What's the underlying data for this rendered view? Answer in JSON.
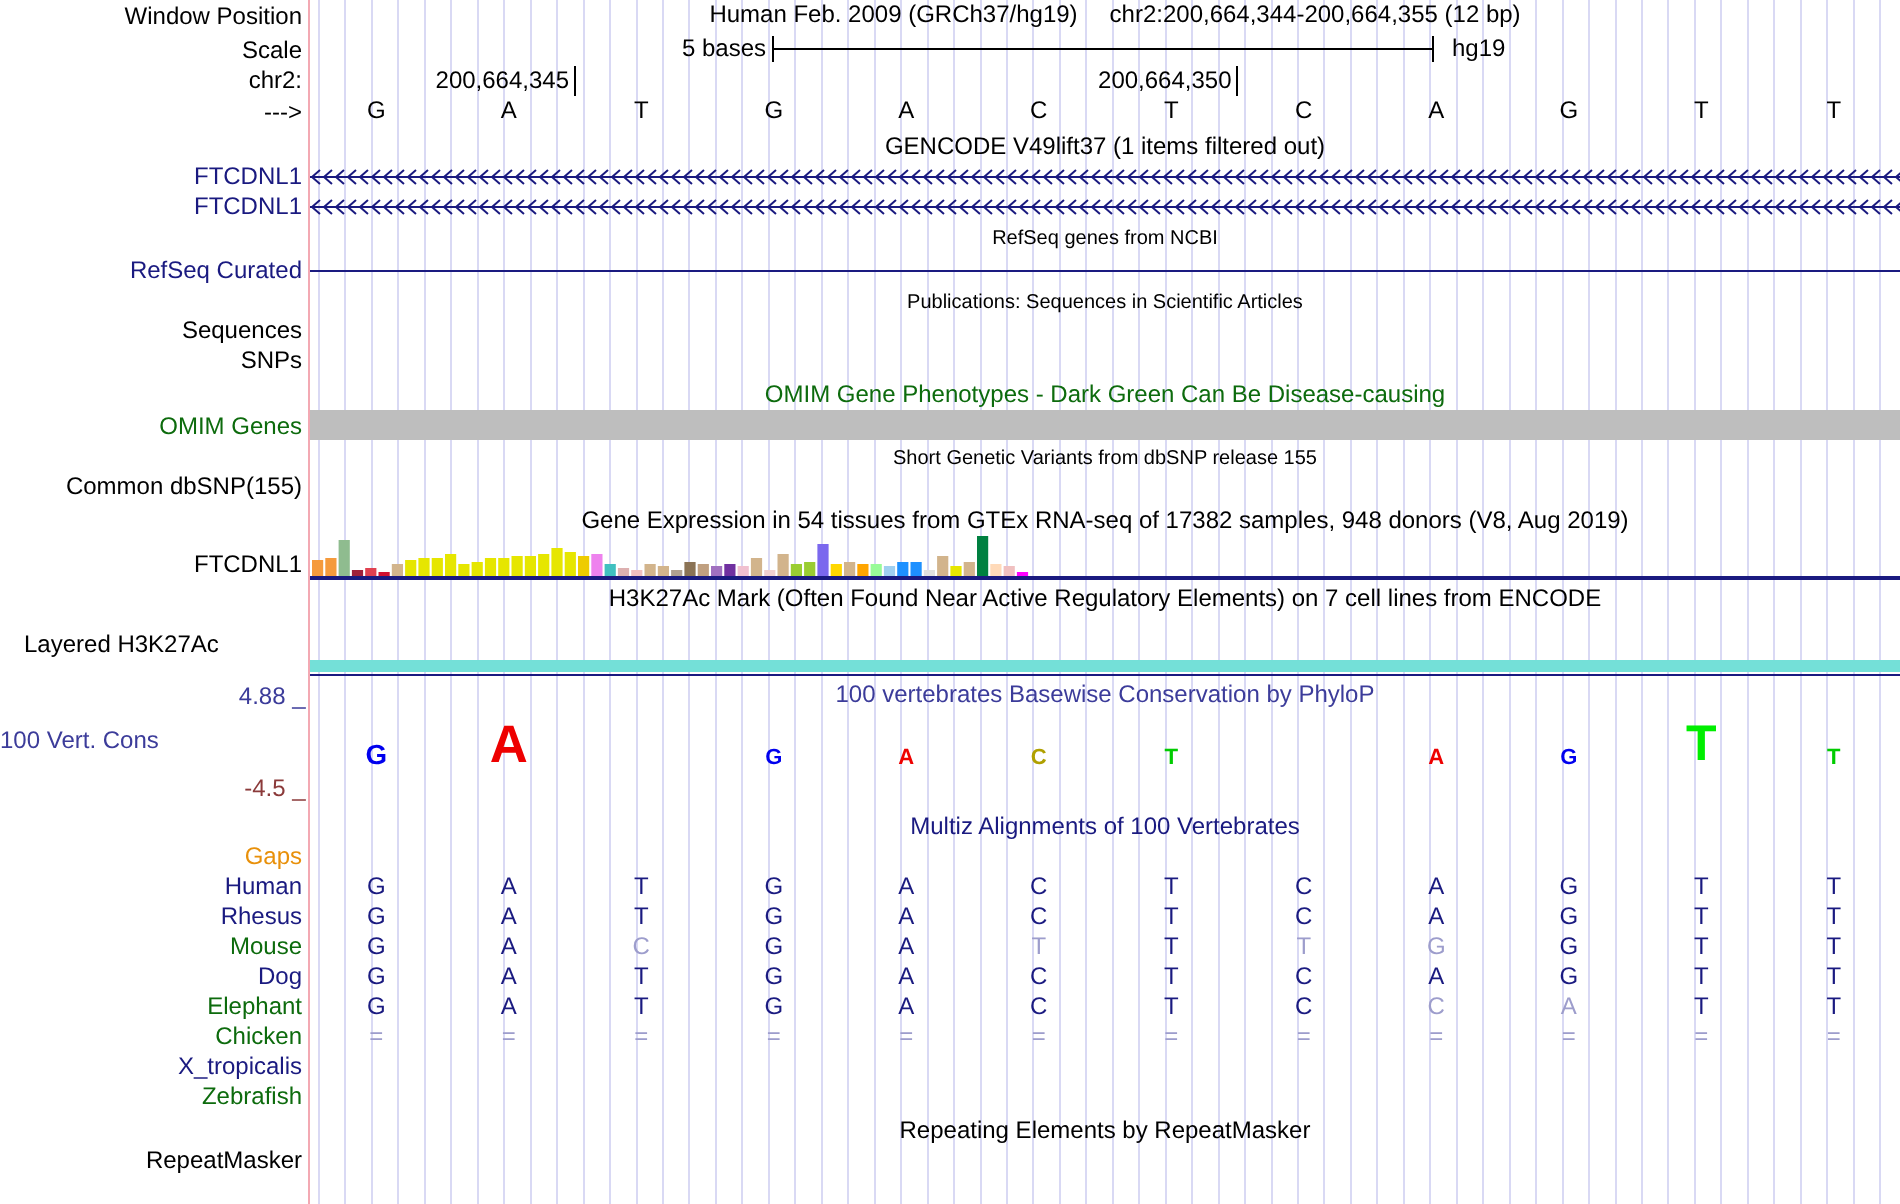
{
  "position_row": {
    "label": "Window Position",
    "assembly": "Human Feb. 2009 (GRCh37/hg19)",
    "range": "chr2:200,664,344-200,664,355 (12 bp)"
  },
  "scale_row": {
    "label": "Scale",
    "span": "5 bases",
    "genome": "hg19"
  },
  "coordinate_row": {
    "label": "chr2:",
    "positions": [
      "200,664,345",
      "200,664,350"
    ]
  },
  "sequence_row": {
    "label": "--->",
    "bases": [
      "G",
      "A",
      "T",
      "G",
      "A",
      "C",
      "T",
      "C",
      "A",
      "G",
      "T",
      "T"
    ]
  },
  "tracks": [
    {
      "kind": "title",
      "text": "GENCODE V49lift37 (1 items filtered out)",
      "color": "#000000"
    },
    {
      "kind": "gene",
      "label": "FTCDNL1",
      "color": "#1a1a80"
    },
    {
      "kind": "gene",
      "label": "FTCDNL1",
      "color": "#1a1a80"
    },
    {
      "kind": "note",
      "text": "RefSeq genes from NCBI"
    },
    {
      "kind": "line",
      "label": "RefSeq Curated",
      "color": "#1a1a80"
    },
    {
      "kind": "note",
      "text": "Publications: Sequences in Scientific Articles"
    },
    {
      "kind": "empty",
      "label": "Sequences",
      "color": "#000000"
    },
    {
      "kind": "empty",
      "label": "SNPs",
      "color": "#000000"
    },
    {
      "kind": "title",
      "text": "OMIM Gene Phenotypes - Dark Green Can Be Disease-causing",
      "color": "#0d6b0d"
    },
    {
      "kind": "bar",
      "label": "OMIM Genes",
      "color": "#0d6b0d"
    },
    {
      "kind": "note",
      "text": "Short Genetic Variants from dbSNP release 155"
    },
    {
      "kind": "empty",
      "label": "Common dbSNP(155)",
      "color": "#000000"
    },
    {
      "kind": "title",
      "text": "Gene Expression in 54 tissues from GTEx RNA-seq of 17382 samples, 948 donors (V8, Aug 2019)",
      "color": "#000000"
    },
    {
      "kind": "expression",
      "label": "FTCDNL1",
      "color": "#000000"
    },
    {
      "kind": "title",
      "text": "H3K27Ac Mark (Often Found Near Active Regulatory Elements) on 7 cell lines from ENCODE",
      "color": "#000000"
    },
    {
      "kind": "signal",
      "label": "Layered H3K27Ac",
      "color": "#000000"
    },
    {
      "kind": "conservation",
      "label": "100 Vert. Cons",
      "color": "#3c3c9a",
      "max": "4.88 _",
      "min": "-4.5 _",
      "title": "100 vertebrates Basewise Conservation by PhyloP",
      "logo": [
        {
          "base": "G",
          "color": "#0000ee"
        },
        {
          "base": "A",
          "color": "#ee0000"
        },
        {
          "base": "G",
          "color": "#0000ee"
        },
        {
          "base": "A",
          "color": "#ee0000"
        },
        {
          "base": "C",
          "color": "#b0a000"
        },
        {
          "base": "T",
          "color": "#00cc00"
        },
        {
          "base": "A",
          "color": "#ee0000"
        },
        {
          "base": "G",
          "color": "#0000ee"
        },
        {
          "base": "T",
          "color": "#00ee00"
        },
        {
          "base": "T",
          "color": "#00cc00"
        }
      ]
    },
    {
      "kind": "title",
      "text": "Multiz Alignments of 100 Vertebrates",
      "color": "#1a1a80"
    },
    {
      "kind": "alignment",
      "gaps": {
        "label": "Gaps",
        "color": "#e8900a"
      },
      "species": [
        {
          "name": "Human",
          "color": "#1a1a80",
          "bases": [
            {
              "base": "G",
              "faded": false
            },
            {
              "base": "A",
              "faded": false
            },
            {
              "base": "T",
              "faded": false
            },
            {
              "base": "G",
              "faded": false
            },
            {
              "base": "A",
              "faded": false
            },
            {
              "base": "C",
              "faded": false
            },
            {
              "base": "T",
              "faded": false
            },
            {
              "base": "C",
              "faded": false
            },
            {
              "base": "A",
              "faded": false
            },
            {
              "base": "G",
              "faded": false
            },
            {
              "base": "T",
              "faded": false
            },
            {
              "base": "T",
              "faded": false
            }
          ]
        },
        {
          "name": "Rhesus",
          "color": "#1a1a80",
          "bases": [
            {
              "base": "G",
              "faded": false
            },
            {
              "base": "A",
              "faded": false
            },
            {
              "base": "T",
              "faded": false
            },
            {
              "base": "G",
              "faded": false
            },
            {
              "base": "A",
              "faded": false
            },
            {
              "base": "C",
              "faded": false
            },
            {
              "base": "T",
              "faded": false
            },
            {
              "base": "C",
              "faded": false
            },
            {
              "base": "A",
              "faded": false
            },
            {
              "base": "G",
              "faded": false
            },
            {
              "base": "T",
              "faded": false
            },
            {
              "base": "T",
              "faded": false
            }
          ]
        },
        {
          "name": "Mouse",
          "color": "#0d6b0d",
          "bases": [
            {
              "base": "G",
              "faded": false
            },
            {
              "base": "A",
              "faded": false
            },
            {
              "base": "C",
              "faded": true
            },
            {
              "base": "G",
              "faded": false
            },
            {
              "base": "A",
              "faded": false
            },
            {
              "base": "T",
              "faded": true
            },
            {
              "base": "T",
              "faded": false
            },
            {
              "base": "T",
              "faded": true
            },
            {
              "base": "G",
              "faded": true
            },
            {
              "base": "G",
              "faded": false
            },
            {
              "base": "T",
              "faded": false
            },
            {
              "base": "T",
              "faded": false
            }
          ]
        },
        {
          "name": "Dog",
          "color": "#1a1a80",
          "bases": [
            {
              "base": "G",
              "faded": false
            },
            {
              "base": "A",
              "faded": false
            },
            {
              "base": "T",
              "faded": false
            },
            {
              "base": "G",
              "faded": false
            },
            {
              "base": "A",
              "faded": false
            },
            {
              "base": "C",
              "faded": false
            },
            {
              "base": "T",
              "faded": false
            },
            {
              "base": "C",
              "faded": false
            },
            {
              "base": "A",
              "faded": false
            },
            {
              "base": "G",
              "faded": false
            },
            {
              "base": "T",
              "faded": false
            },
            {
              "base": "T",
              "faded": false
            }
          ]
        },
        {
          "name": "Elephant",
          "color": "#0d6b0d",
          "bases": [
            {
              "base": "G",
              "faded": false
            },
            {
              "base": "A",
              "faded": false
            },
            {
              "base": "T",
              "faded": false
            },
            {
              "base": "G",
              "faded": false
            },
            {
              "base": "A",
              "faded": false
            },
            {
              "base": "C",
              "faded": false
            },
            {
              "base": "T",
              "faded": false
            },
            {
              "base": "C",
              "faded": false
            },
            {
              "base": "C",
              "faded": true
            },
            {
              "base": "A",
              "faded": true
            },
            {
              "base": "T",
              "faded": false
            },
            {
              "base": "T",
              "faded": false
            }
          ]
        },
        {
          "name": "Chicken",
          "color": "#0d6b0d",
          "bases": [
            {
              "base": "=",
              "faded": true
            },
            {
              "base": "=",
              "faded": true
            },
            {
              "base": "=",
              "faded": true
            },
            {
              "base": "=",
              "faded": true
            },
            {
              "base": "=",
              "faded": true
            },
            {
              "base": "=",
              "faded": true
            },
            {
              "base": "=",
              "faded": true
            },
            {
              "base": "=",
              "faded": true
            },
            {
              "base": "=",
              "faded": true
            },
            {
              "base": "=",
              "faded": true
            },
            {
              "base": "=",
              "faded": true
            },
            {
              "base": "=",
              "faded": true
            }
          ]
        },
        {
          "name": "X_tropicalis",
          "color": "#1a1a80"
        },
        {
          "name": "Zebrafish",
          "color": "#0d6b0d"
        }
      ]
    },
    {
      "kind": "title",
      "text": "Repeating Elements by RepeatMasker",
      "color": "#000000"
    },
    {
      "kind": "empty",
      "label": "RepeatMasker",
      "color": "#000000"
    }
  ]
}
